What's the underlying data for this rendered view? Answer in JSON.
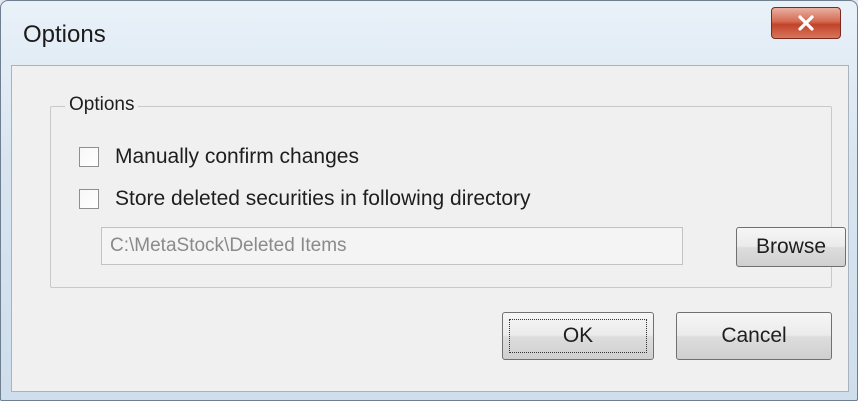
{
  "window": {
    "title": "Options"
  },
  "group": {
    "legend": "Options"
  },
  "options": [
    {
      "label": "Manually confirm changes",
      "checked": false
    },
    {
      "label": "Store deleted securities in following directory",
      "checked": false
    }
  ],
  "directory": {
    "value": "C:\\MetaStock\\Deleted Items"
  },
  "buttons": {
    "browse": "Browse",
    "ok": "OK",
    "cancel": "Cancel"
  },
  "colors": {
    "close_button": "#c1432a",
    "dialog_background": "#f0f0f0"
  },
  "icons": {
    "close": "close-icon"
  }
}
